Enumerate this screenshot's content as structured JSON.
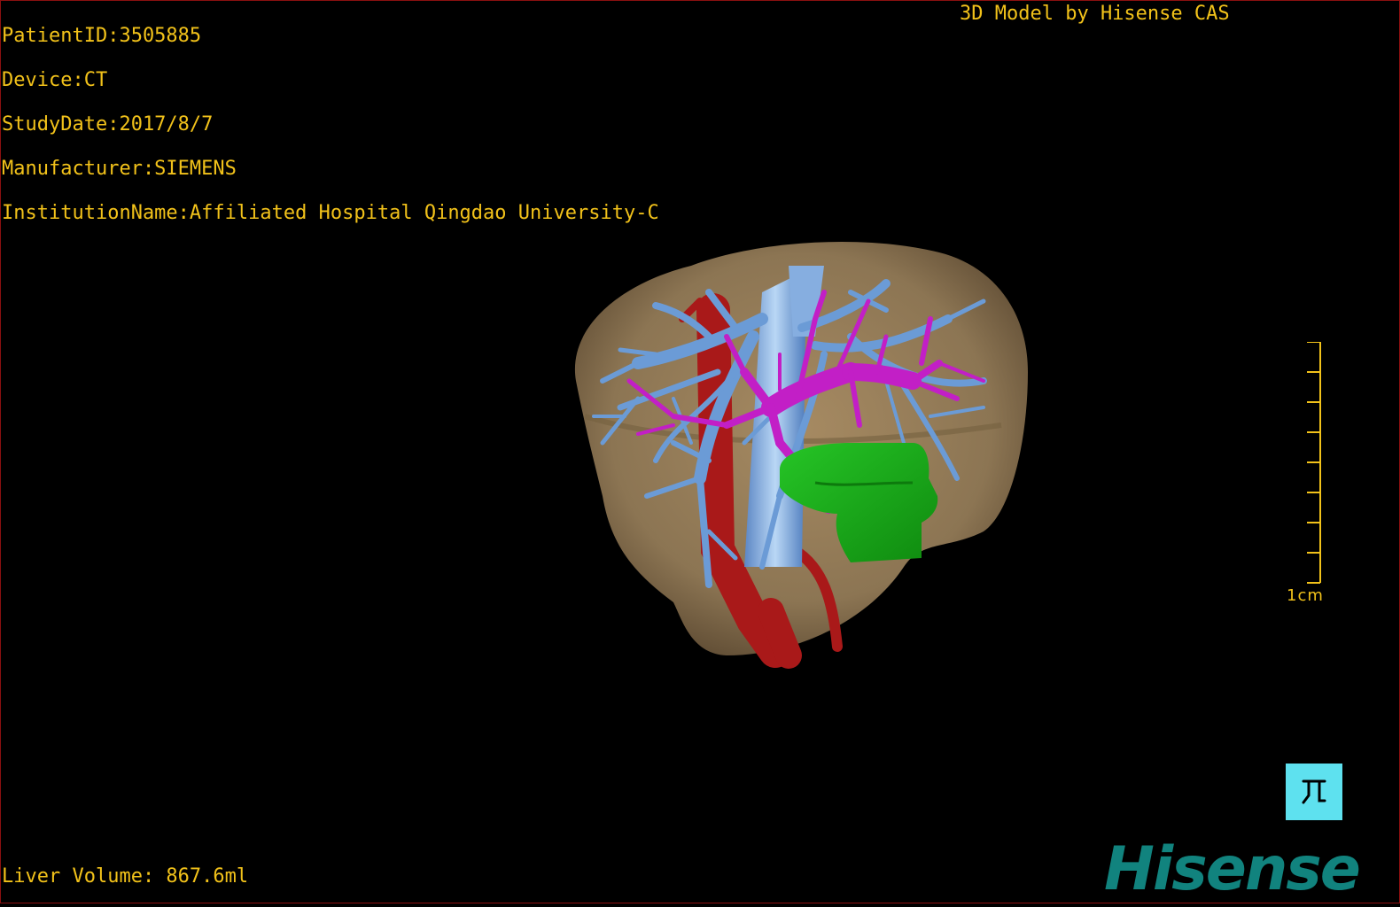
{
  "overlay": {
    "patient_id": "PatientID:3505885",
    "device": "Device:CT",
    "study_date": "StudyDate:2017/8/7",
    "manufacturer": "Manufacturer:SIEMENS",
    "institution": "InstitutionName:Affiliated Hospital Qingdao University-C",
    "model_credit": "3D Model by Hisense CAS",
    "liver_volume": "Liver Volume: 867.6ml"
  },
  "scale": {
    "label": "1cm"
  },
  "brand": {
    "logo_text": "Hisense"
  },
  "icons": {
    "orientation": "orientation-reset-icon"
  },
  "colors": {
    "text": "#f2c21a",
    "liver": "#8c7553",
    "portal_vein": "#6b9bd6",
    "hepatic_vein": "#c21fc6",
    "artery_ivc": "#a91919",
    "tumor": "#1bb01b",
    "button": "#5ee1ef",
    "brand": "#11837e"
  }
}
